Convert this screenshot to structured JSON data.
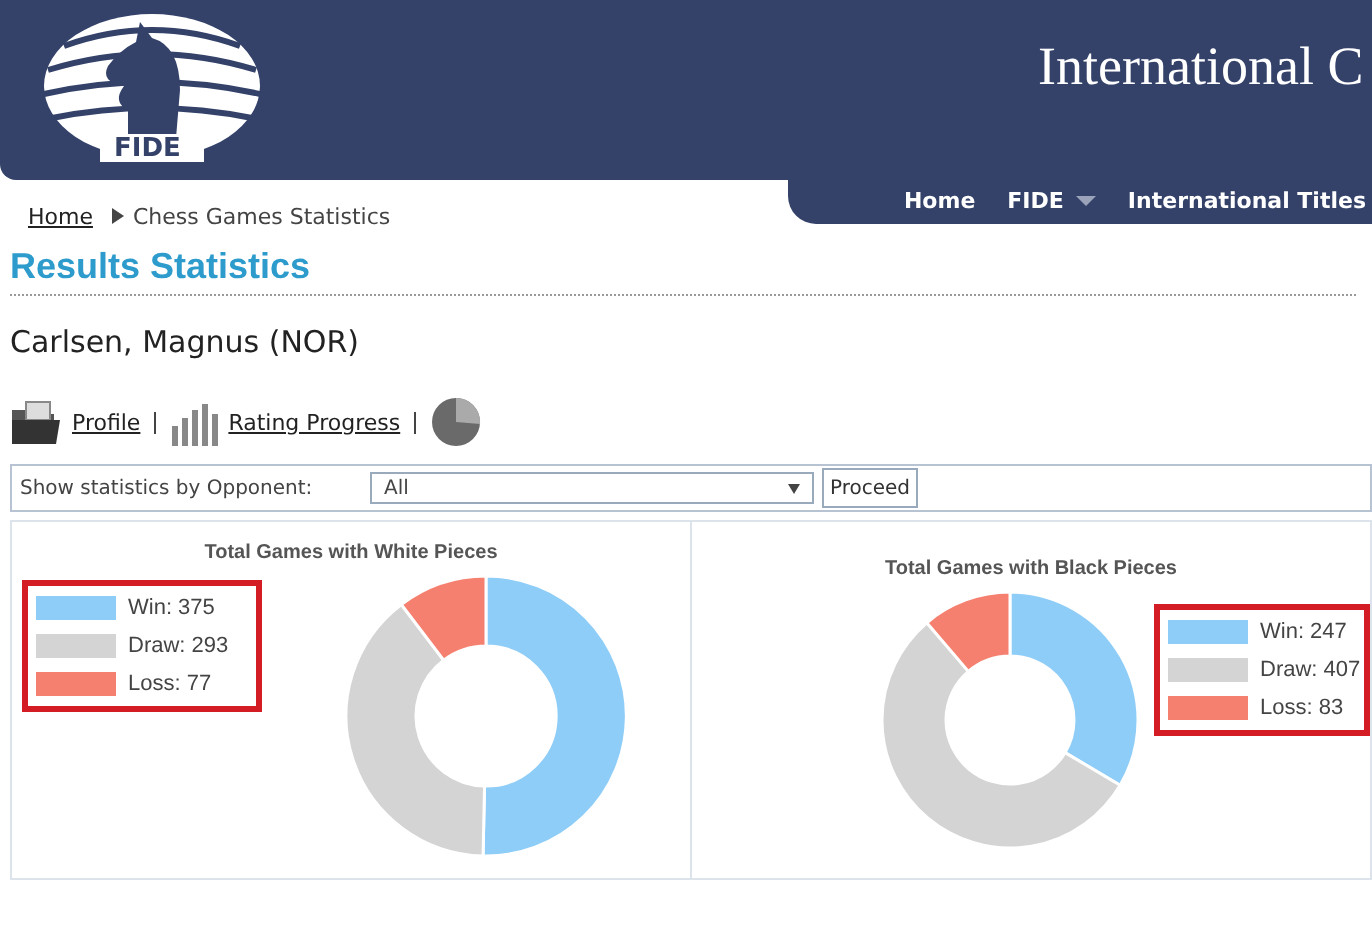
{
  "header": {
    "title": "International C",
    "logo_text": "FIDE"
  },
  "nav": [
    {
      "label": "Home",
      "kind": "link"
    },
    {
      "label": "FIDE",
      "kind": "dropdown"
    },
    {
      "label": "International Titles",
      "kind": "link"
    }
  ],
  "breadcrumb": [
    {
      "label": "Home",
      "kind": "link"
    },
    {
      "label": "Chess Games Statistics",
      "kind": "current"
    }
  ],
  "page_title": "Results Statistics",
  "player": "Carlsen, Magnus (NOR)",
  "links": [
    {
      "label": "Profile",
      "kind": "folder"
    },
    {
      "label": "Rating Progress",
      "kind": "bars"
    },
    {
      "kind": "pie"
    }
  ],
  "filter": {
    "label": "Show statistics by Opponent:",
    "value": "All",
    "button": "Proceed"
  },
  "panels": [
    {
      "legend": [
        {
          "color": "#8ecdf7"
        },
        {
          "color": "#d4d4d4"
        },
        {
          "color": "#f5806f"
        }
      ],
      "chart_data": {
        "type": "donut",
        "title": "Total Games with White Pieces",
        "categories": [
          "Win: 375",
          "Draw: 293",
          "Loss: 77"
        ],
        "values": [
          375,
          293,
          77
        ]
      }
    },
    {
      "legend": [
        {
          "color": "#8ecdf7"
        },
        {
          "color": "#d4d4d4"
        },
        {
          "color": "#f5806f"
        }
      ],
      "chart_data": {
        "type": "donut",
        "title": "Total Games with Black Pieces",
        "categories": [
          "Win: 247",
          "Draw: 407",
          "Loss: 83"
        ],
        "values": [
          247,
          407,
          83
        ]
      }
    }
  ]
}
